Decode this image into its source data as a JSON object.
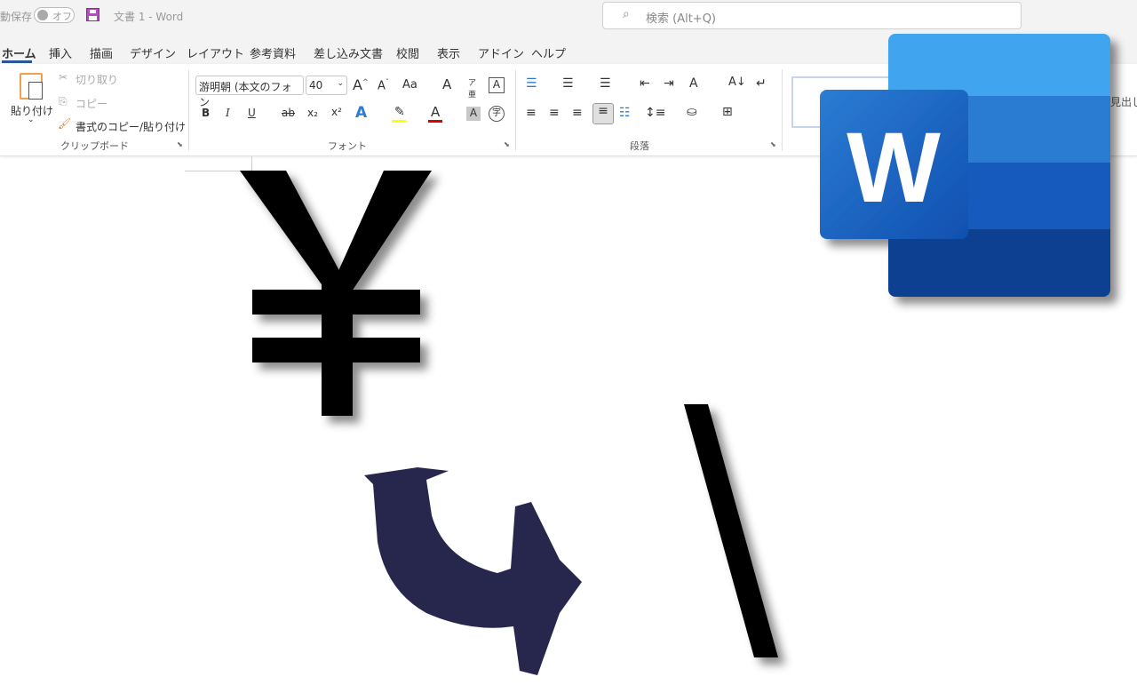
{
  "titlebar": {
    "autosave_label": "動保存",
    "autosave_toggle": "オフ",
    "doc_title": "文書 1  -  Word",
    "search_placeholder": "検索 (Alt+Q)"
  },
  "tabs": [
    "ホーム",
    "挿入",
    "描画",
    "デザイン",
    "レイアウト",
    "参考資料",
    "差し込み文書",
    "校閲",
    "表示",
    "アドイン",
    "ヘルプ"
  ],
  "active_tab": "ホーム",
  "clipboard": {
    "paste": "貼り付け",
    "cut": "切り取り",
    "copy": "コピー",
    "format_painter": "書式のコピー/貼り付け",
    "group": "クリップボード"
  },
  "font": {
    "name": "游明朝 (本文のフォン",
    "size": "40",
    "group": "フォント",
    "change_case": "Aa",
    "bold": "B",
    "italic": "I",
    "underline": "U",
    "strike": "ab",
    "subscript": "x₂",
    "superscript": "x²",
    "text_effect": "A",
    "highlight_color": "#ffff00",
    "font_color": "#e00000",
    "char_shading": "A",
    "enclosed": "字"
  },
  "paragraph": {
    "group": "段落"
  },
  "styles": {
    "heading_partial": "見出し"
  },
  "overlay": {
    "yen_symbol": "¥",
    "backslash": "\\",
    "arrow": "hand-drawn-curved-arrow",
    "logo": "W"
  },
  "colors": {
    "word_blue_1": "#41a5ee",
    "word_blue_2": "#2b7cd3",
    "word_blue_3": "#185abd",
    "word_blue_4": "#103f91",
    "arrow": "#1b1b45",
    "tab_underline": "#2b579a"
  }
}
